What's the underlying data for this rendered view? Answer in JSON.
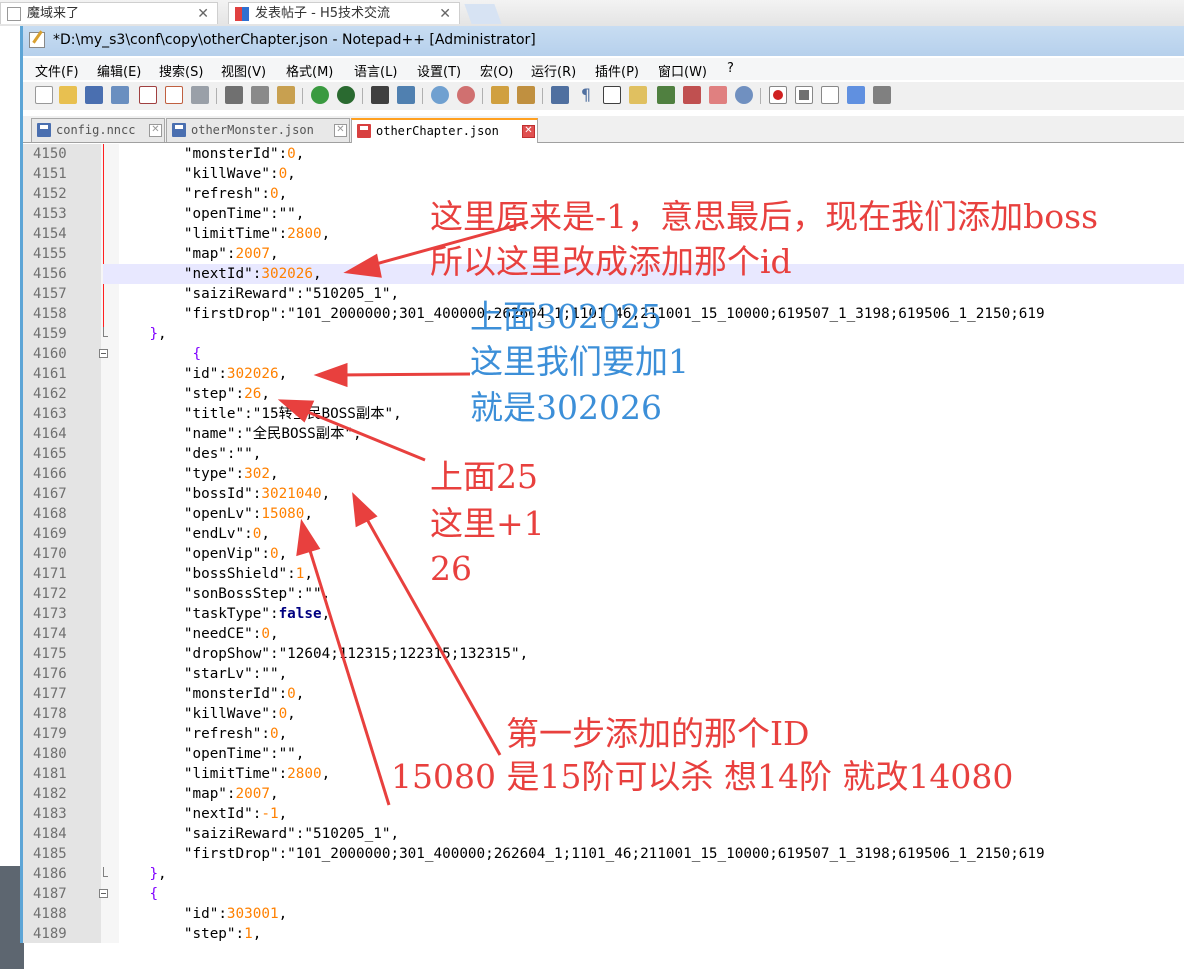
{
  "browser": {
    "tabs": [
      {
        "label": "魔域来了"
      },
      {
        "label": "发表帖子 - H5技术交流"
      }
    ]
  },
  "window": {
    "title": "*D:\\my_s3\\conf\\copy\\otherChapter.json - Notepad++ [Administrator]"
  },
  "menu": [
    "文件(F)",
    "编辑(E)",
    "搜索(S)",
    "视图(V)",
    "格式(M)",
    "语言(L)",
    "设置(T)",
    "宏(O)",
    "运行(R)",
    "插件(P)",
    "窗口(W)",
    "?"
  ],
  "file_tabs": [
    {
      "label": "config.nncc",
      "active": false
    },
    {
      "label": "otherMonster.json",
      "active": false
    },
    {
      "label": "otherChapter.json",
      "active": true
    }
  ],
  "editor": {
    "lines": [
      {
        "num": "4150",
        "tokens": [
          [
            "        ",
            "k"
          ],
          [
            "\"monsterId\"",
            "k"
          ],
          [
            ":",
            "k"
          ],
          [
            "0",
            "n"
          ],
          [
            ",",
            "k"
          ]
        ]
      },
      {
        "num": "4151",
        "tokens": [
          [
            "        ",
            "k"
          ],
          [
            "\"killWave\"",
            "k"
          ],
          [
            ":",
            "k"
          ],
          [
            "0",
            "n"
          ],
          [
            ",",
            "k"
          ]
        ]
      },
      {
        "num": "4152",
        "tokens": [
          [
            "        ",
            "k"
          ],
          [
            "\"refresh\"",
            "k"
          ],
          [
            ":",
            "k"
          ],
          [
            "0",
            "n"
          ],
          [
            ",",
            "k"
          ]
        ]
      },
      {
        "num": "4153",
        "tokens": [
          [
            "        ",
            "k"
          ],
          [
            "\"openTime\"",
            "k"
          ],
          [
            ":",
            "k"
          ],
          [
            "\"\"",
            "k"
          ],
          [
            ",",
            "k"
          ]
        ]
      },
      {
        "num": "4154",
        "tokens": [
          [
            "        ",
            "k"
          ],
          [
            "\"limitTime\"",
            "k"
          ],
          [
            ":",
            "k"
          ],
          [
            "2800",
            "n"
          ],
          [
            ",",
            "k"
          ]
        ]
      },
      {
        "num": "4155",
        "tokens": [
          [
            "        ",
            "k"
          ],
          [
            "\"map\"",
            "k"
          ],
          [
            ":",
            "k"
          ],
          [
            "2007",
            "n"
          ],
          [
            ",",
            "k"
          ]
        ]
      },
      {
        "num": "4156",
        "tokens": [
          [
            "        ",
            "k"
          ],
          [
            "\"nextId\"",
            "k"
          ],
          [
            ":",
            "k"
          ],
          [
            "302026",
            "n"
          ],
          [
            ",",
            "k"
          ]
        ],
        "highlight": true
      },
      {
        "num": "4157",
        "tokens": [
          [
            "        ",
            "k"
          ],
          [
            "\"saiziReward\"",
            "k"
          ],
          [
            ":",
            "k"
          ],
          [
            "\"510205_1\"",
            "k"
          ],
          [
            ",",
            "k"
          ]
        ]
      },
      {
        "num": "4158",
        "tokens": [
          [
            "        ",
            "k"
          ],
          [
            "\"firstDrop\"",
            "k"
          ],
          [
            ":",
            "k"
          ],
          [
            "\"101_2000000;301_400000;262604_1;1101_46;211001_15_10000;619507_1_3198;619506_1_2150;619",
            "k"
          ]
        ]
      },
      {
        "num": "4159",
        "tokens": [
          [
            "    ",
            "k"
          ],
          [
            "}",
            "br"
          ],
          [
            ",",
            "k"
          ]
        ]
      },
      {
        "num": "4160",
        "tokens": [
          [
            "         ",
            "k"
          ],
          [
            "{",
            "br"
          ]
        ]
      },
      {
        "num": "4161",
        "tokens": [
          [
            "        ",
            "k"
          ],
          [
            "\"id\"",
            "k"
          ],
          [
            ":",
            "k"
          ],
          [
            "302026",
            "n"
          ],
          [
            ",",
            "k"
          ]
        ]
      },
      {
        "num": "4162",
        "tokens": [
          [
            "        ",
            "k"
          ],
          [
            "\"step\"",
            "k"
          ],
          [
            ":",
            "k"
          ],
          [
            "26",
            "n"
          ],
          [
            ",",
            "k"
          ]
        ]
      },
      {
        "num": "4163",
        "tokens": [
          [
            "        ",
            "k"
          ],
          [
            "\"title\"",
            "k"
          ],
          [
            ":",
            "k"
          ],
          [
            "\"15转全民BOSS副本\"",
            "k"
          ],
          [
            ",",
            "k"
          ]
        ]
      },
      {
        "num": "4164",
        "tokens": [
          [
            "        ",
            "k"
          ],
          [
            "\"name\"",
            "k"
          ],
          [
            ":",
            "k"
          ],
          [
            "\"全民BOSS副本\"",
            "k"
          ],
          [
            ",",
            "k"
          ]
        ]
      },
      {
        "num": "4165",
        "tokens": [
          [
            "        ",
            "k"
          ],
          [
            "\"des\"",
            "k"
          ],
          [
            ":",
            "k"
          ],
          [
            "\"\"",
            "k"
          ],
          [
            ",",
            "k"
          ]
        ]
      },
      {
        "num": "4166",
        "tokens": [
          [
            "        ",
            "k"
          ],
          [
            "\"type\"",
            "k"
          ],
          [
            ":",
            "k"
          ],
          [
            "302",
            "n"
          ],
          [
            ",",
            "k"
          ]
        ]
      },
      {
        "num": "4167",
        "tokens": [
          [
            "        ",
            "k"
          ],
          [
            "\"bossId\"",
            "k"
          ],
          [
            ":",
            "k"
          ],
          [
            "3021040",
            "n"
          ],
          [
            ",",
            "k"
          ]
        ]
      },
      {
        "num": "4168",
        "tokens": [
          [
            "        ",
            "k"
          ],
          [
            "\"openLv\"",
            "k"
          ],
          [
            ":",
            "k"
          ],
          [
            "15080",
            "n"
          ],
          [
            ",",
            "k"
          ]
        ]
      },
      {
        "num": "4169",
        "tokens": [
          [
            "        ",
            "k"
          ],
          [
            "\"endLv\"",
            "k"
          ],
          [
            ":",
            "k"
          ],
          [
            "0",
            "n"
          ],
          [
            ",",
            "k"
          ]
        ]
      },
      {
        "num": "4170",
        "tokens": [
          [
            "        ",
            "k"
          ],
          [
            "\"openVip\"",
            "k"
          ],
          [
            ":",
            "k"
          ],
          [
            "0",
            "n"
          ],
          [
            ",",
            "k"
          ]
        ]
      },
      {
        "num": "4171",
        "tokens": [
          [
            "        ",
            "k"
          ],
          [
            "\"bossShield\"",
            "k"
          ],
          [
            ":",
            "k"
          ],
          [
            "1",
            "n"
          ],
          [
            ",",
            "k"
          ]
        ]
      },
      {
        "num": "4172",
        "tokens": [
          [
            "        ",
            "k"
          ],
          [
            "\"sonBossStep\"",
            "k"
          ],
          [
            ":",
            "k"
          ],
          [
            "\"\"",
            "k"
          ],
          [
            ",",
            "k"
          ]
        ]
      },
      {
        "num": "4173",
        "tokens": [
          [
            "        ",
            "k"
          ],
          [
            "\"taskType\"",
            "k"
          ],
          [
            ":",
            "k"
          ],
          [
            "false",
            "b"
          ],
          [
            ",",
            "k"
          ]
        ]
      },
      {
        "num": "4174",
        "tokens": [
          [
            "        ",
            "k"
          ],
          [
            "\"needCE\"",
            "k"
          ],
          [
            ":",
            "k"
          ],
          [
            "0",
            "n"
          ],
          [
            ",",
            "k"
          ]
        ]
      },
      {
        "num": "4175",
        "tokens": [
          [
            "        ",
            "k"
          ],
          [
            "\"dropShow\"",
            "k"
          ],
          [
            ":",
            "k"
          ],
          [
            "\"12604;112315;122315;132315\"",
            "k"
          ],
          [
            ",",
            "k"
          ]
        ]
      },
      {
        "num": "4176",
        "tokens": [
          [
            "        ",
            "k"
          ],
          [
            "\"starLv\"",
            "k"
          ],
          [
            ":",
            "k"
          ],
          [
            "\"\"",
            "k"
          ],
          [
            ",",
            "k"
          ]
        ]
      },
      {
        "num": "4177",
        "tokens": [
          [
            "        ",
            "k"
          ],
          [
            "\"monsterId\"",
            "k"
          ],
          [
            ":",
            "k"
          ],
          [
            "0",
            "n"
          ],
          [
            ",",
            "k"
          ]
        ]
      },
      {
        "num": "4178",
        "tokens": [
          [
            "        ",
            "k"
          ],
          [
            "\"killWave\"",
            "k"
          ],
          [
            ":",
            "k"
          ],
          [
            "0",
            "n"
          ],
          [
            ",",
            "k"
          ]
        ]
      },
      {
        "num": "4179",
        "tokens": [
          [
            "        ",
            "k"
          ],
          [
            "\"refresh\"",
            "k"
          ],
          [
            ":",
            "k"
          ],
          [
            "0",
            "n"
          ],
          [
            ",",
            "k"
          ]
        ]
      },
      {
        "num": "4180",
        "tokens": [
          [
            "        ",
            "k"
          ],
          [
            "\"openTime\"",
            "k"
          ],
          [
            ":",
            "k"
          ],
          [
            "\"\"",
            "k"
          ],
          [
            ",",
            "k"
          ]
        ]
      },
      {
        "num": "4181",
        "tokens": [
          [
            "        ",
            "k"
          ],
          [
            "\"limitTime\"",
            "k"
          ],
          [
            ":",
            "k"
          ],
          [
            "2800",
            "n"
          ],
          [
            ",",
            "k"
          ]
        ]
      },
      {
        "num": "4182",
        "tokens": [
          [
            "        ",
            "k"
          ],
          [
            "\"map\"",
            "k"
          ],
          [
            ":",
            "k"
          ],
          [
            "2007",
            "n"
          ],
          [
            ",",
            "k"
          ]
        ]
      },
      {
        "num": "4183",
        "tokens": [
          [
            "        ",
            "k"
          ],
          [
            "\"nextId\"",
            "k"
          ],
          [
            ":",
            "k"
          ],
          [
            "-1",
            "n"
          ],
          [
            ",",
            "k"
          ]
        ]
      },
      {
        "num": "4184",
        "tokens": [
          [
            "        ",
            "k"
          ],
          [
            "\"saiziReward\"",
            "k"
          ],
          [
            ":",
            "k"
          ],
          [
            "\"510205_1\"",
            "k"
          ],
          [
            ",",
            "k"
          ]
        ]
      },
      {
        "num": "4185",
        "tokens": [
          [
            "        ",
            "k"
          ],
          [
            "\"firstDrop\"",
            "k"
          ],
          [
            ":",
            "k"
          ],
          [
            "\"101_2000000;301_400000;262604_1;1101_46;211001_15_10000;619507_1_3198;619506_1_2150;619",
            "k"
          ]
        ]
      },
      {
        "num": "4186",
        "tokens": [
          [
            "    ",
            "k"
          ],
          [
            "}",
            "br"
          ],
          [
            ",",
            "k"
          ]
        ]
      },
      {
        "num": "4187",
        "tokens": [
          [
            "    ",
            "k"
          ],
          [
            "{",
            "br"
          ]
        ]
      },
      {
        "num": "4188",
        "tokens": [
          [
            "        ",
            "k"
          ],
          [
            "\"id\"",
            "k"
          ],
          [
            ":",
            "k"
          ],
          [
            "303001",
            "n"
          ],
          [
            ",",
            "k"
          ]
        ]
      },
      {
        "num": "4189",
        "tokens": [
          [
            "        ",
            "k"
          ],
          [
            "\"step\"",
            "k"
          ],
          [
            ":",
            "k"
          ],
          [
            "1",
            "n"
          ],
          [
            ",",
            "k"
          ]
        ]
      }
    ]
  },
  "annotations": {
    "a1_line1": "这里原来是-1，意思最后，现在我们添加boss",
    "a1_line2": "所以这里改成添加那个id",
    "a2_line1": "上面302025",
    "a2_line2": "这里我们要加1",
    "a2_line3": "就是302026",
    "a3_line1": "上面25",
    "a3_line2": "这里+1",
    "a3_line3": "26",
    "a4_line1": "第一步添加的那个ID",
    "a4_line2": "15080  是15阶可以杀  想14阶  就改14080",
    "colors": {
      "red": "#e8403e",
      "blue": "#3c8fd8"
    }
  }
}
